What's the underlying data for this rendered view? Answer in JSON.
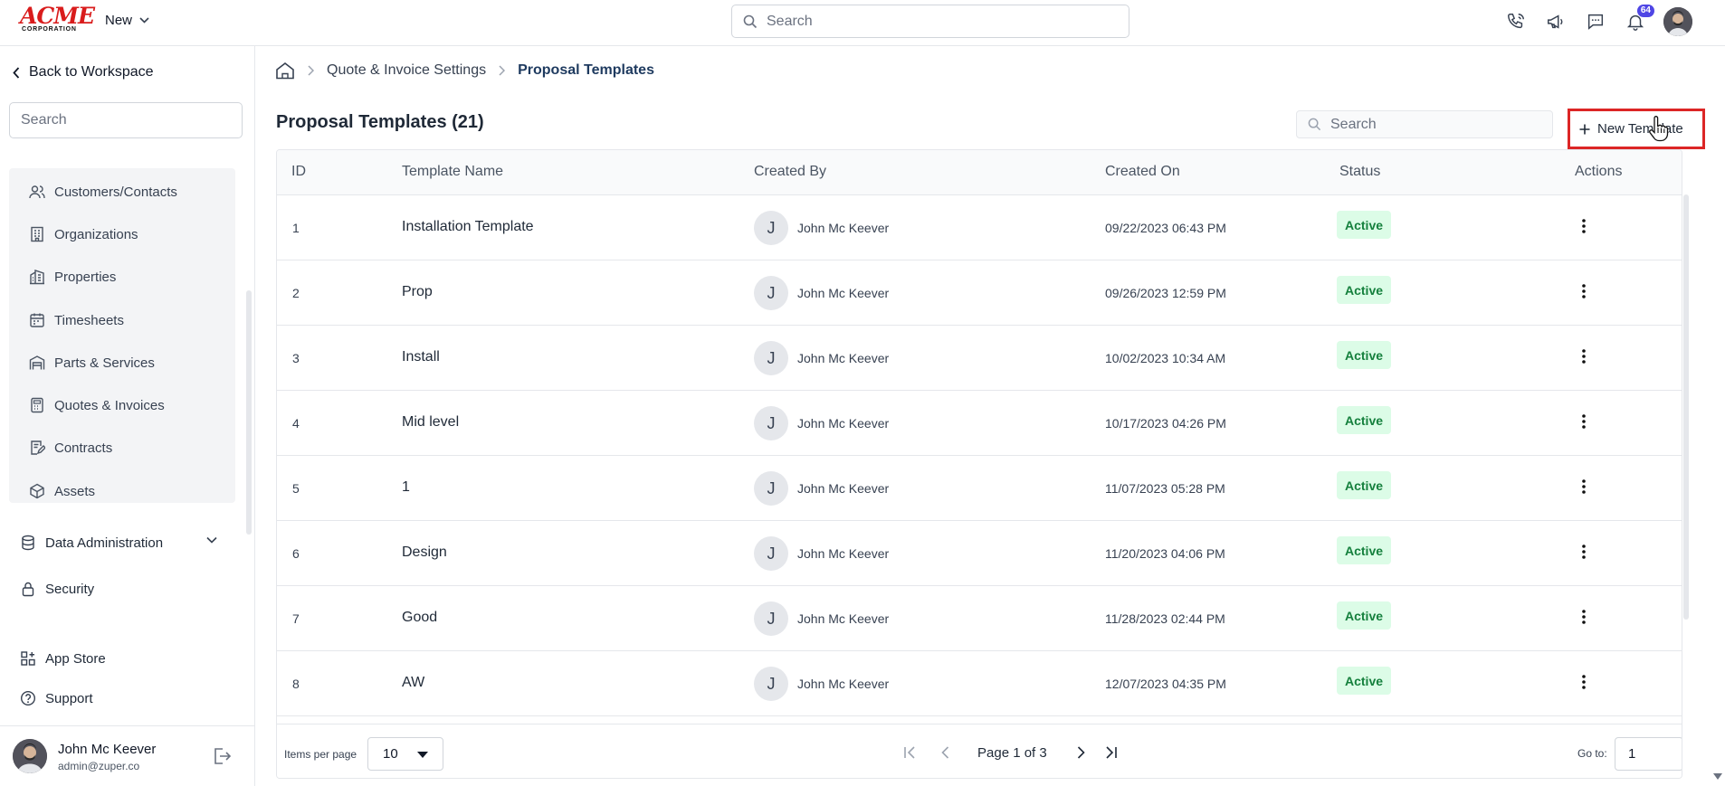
{
  "topbar": {
    "logo_text": "ACME",
    "logo_sub": "CORPORATION",
    "new_label": "New",
    "search_placeholder": "Search",
    "notifications_count": "64",
    "icons": [
      "phone-icon",
      "megaphone-icon",
      "chat-icon",
      "bell-icon"
    ]
  },
  "sidebar": {
    "back_label": "Back to Workspace",
    "search_placeholder": "Search",
    "items": [
      {
        "label": "Customers/Contacts",
        "icon": "users-icon"
      },
      {
        "label": "Organizations",
        "icon": "building-icon"
      },
      {
        "label": "Properties",
        "icon": "properties-icon"
      },
      {
        "label": "Timesheets",
        "icon": "calendar-icon"
      },
      {
        "label": "Parts & Services",
        "icon": "warehouse-icon"
      },
      {
        "label": "Quotes & Invoices",
        "icon": "calculator-icon"
      },
      {
        "label": "Contracts",
        "icon": "contract-icon"
      },
      {
        "label": "Assets",
        "icon": "cube-icon"
      }
    ],
    "data_admin_label": "Data Administration",
    "security_label": "Security",
    "app_store_label": "App Store",
    "support_label": "Support",
    "user": {
      "name": "John Mc Keever",
      "email": "admin@zuper.co"
    }
  },
  "breadcrumb": {
    "parent": "Quote & Invoice Settings",
    "current": "Proposal Templates"
  },
  "main": {
    "title": "Proposal Templates (21)",
    "search_placeholder": "Search",
    "new_template_label": "New Template"
  },
  "table": {
    "columns": [
      "ID",
      "Template Name",
      "Created By",
      "Created On",
      "Status",
      "Actions"
    ],
    "rows": [
      {
        "id": "1",
        "name": "Installation Template",
        "initial": "J",
        "creator": "John Mc Keever",
        "created_on": "09/22/2023 06:43 PM",
        "status": "Active"
      },
      {
        "id": "2",
        "name": "Prop",
        "initial": "J",
        "creator": "John Mc Keever",
        "created_on": "09/26/2023 12:59 PM",
        "status": "Active"
      },
      {
        "id": "3",
        "name": "Install",
        "initial": "J",
        "creator": "John Mc Keever",
        "created_on": "10/02/2023 10:34 AM",
        "status": "Active"
      },
      {
        "id": "4",
        "name": "Mid level",
        "initial": "J",
        "creator": "John Mc Keever",
        "created_on": "10/17/2023 04:26 PM",
        "status": "Active"
      },
      {
        "id": "5",
        "name": "1",
        "initial": "J",
        "creator": "John Mc Keever",
        "created_on": "11/07/2023 05:28 PM",
        "status": "Active"
      },
      {
        "id": "6",
        "name": "Design",
        "initial": "J",
        "creator": "John Mc Keever",
        "created_on": "11/20/2023 04:06 PM",
        "status": "Active"
      },
      {
        "id": "7",
        "name": "Good",
        "initial": "J",
        "creator": "John Mc Keever",
        "created_on": "11/28/2023 02:44 PM",
        "status": "Active"
      },
      {
        "id": "8",
        "name": "AW",
        "initial": "J",
        "creator": "John Mc Keever",
        "created_on": "12/07/2023 04:35 PM",
        "status": "Active"
      }
    ]
  },
  "pagination": {
    "items_per_page_label": "Items per page",
    "items_per_page": "10",
    "page_text": "Page 1 of 3",
    "goto_label": "Go to:",
    "goto_value": "1"
  },
  "colors": {
    "accent_red": "#dc2626",
    "status_bg": "#dcfce7",
    "status_text": "#15803d",
    "badge": "#4f46e5"
  }
}
